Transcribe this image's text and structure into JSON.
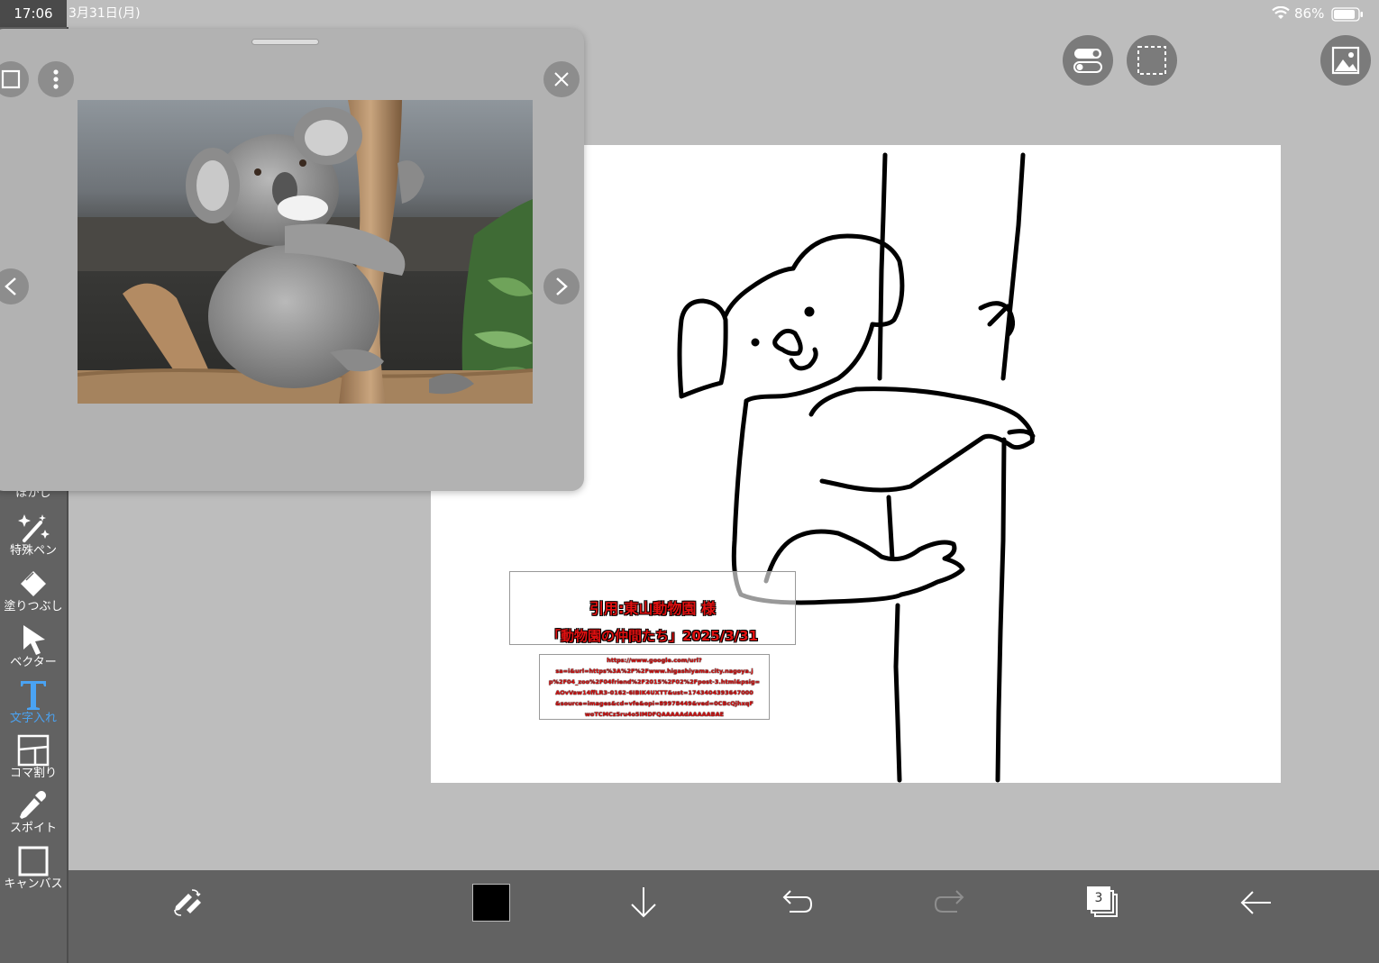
{
  "status": {
    "time": "17:06",
    "date": "3月31日(月)",
    "battery": "86%"
  },
  "tools": [
    {
      "label": "ぼかし",
      "icon": "blur-icon"
    },
    {
      "label": "特殊ペン",
      "icon": "magic-pen-icon"
    },
    {
      "label": "塗りつぶし",
      "icon": "bucket-icon"
    },
    {
      "label": "ベクター",
      "icon": "cursor-arrow-icon"
    },
    {
      "label": "文字入れ",
      "icon": "text-t-icon",
      "active": true
    },
    {
      "label": "コマ割り",
      "icon": "panel-layout-icon"
    },
    {
      "label": "スポイト",
      "icon": "eyedropper-icon"
    },
    {
      "label": "キャンバス",
      "icon": "canvas-frame-icon"
    }
  ],
  "bottom_bar": {
    "layer_count": "3",
    "current_color": "#000000",
    "items": [
      "pen-eraser-swap-icon",
      "color-swatch",
      "download-arrow-icon",
      "undo-icon",
      "redo-icon",
      "layers-icon",
      "back-arrow-icon"
    ]
  },
  "top_right": [
    "toggle-settings-icon",
    "selection-icon",
    "reference-image-icon"
  ],
  "reference_window": {
    "image_subject": "koala-photo",
    "controls": [
      "expand-icon",
      "more-menu-icon",
      "close-icon",
      "prev-icon",
      "next-icon"
    ]
  },
  "canvas": {
    "caption_line1": "引用:東山動物園 様",
    "caption_line2": "「動物園の仲間たち」2025/3/31",
    "url_lines": [
      "https://www.google.com/url?",
      "sa=i&url=https%3A%2F%2Fwww.higashiyama.city.nagoya.j",
      "p%2F04_zoo%2F04friend%2F2015%2F02%2Fpost-3.html&psig=",
      "AOvVaw14ffLR3-0162-6IBIK4UXTT&ust=1743404393647000",
      "&source=images&cd=vfe&opi=89978449&ved=0CBcQjhxqF",
      "woTCMCz5ru4o5IMDFQAAAAAdAAAAABAE"
    ]
  },
  "colors": {
    "background": "#bdbdbd",
    "toolbar": "#626262",
    "active_tool": "#4aa3f3",
    "caption_red": "#e01010"
  }
}
